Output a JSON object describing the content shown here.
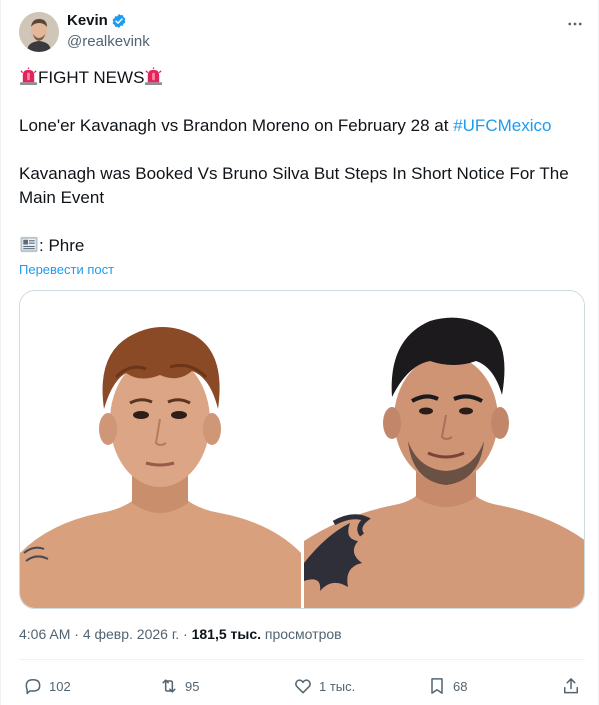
{
  "author": {
    "name": "Kevin",
    "handle": "@realkevink",
    "verified": true
  },
  "tweet": {
    "headline": "FIGHT NEWS",
    "line1_text": "Lone'er Kavanagh vs Brandon Moreno on February 28 at ",
    "line1_hashtag": "#UFCMexico",
    "line2a": "Kavanagh was Booked Vs Bruno Silva But Steps In Short Notice For The",
    "line2b": "Main Event",
    "credit": ": Phre",
    "translate_label": "Перевести пост"
  },
  "meta": {
    "time": "4:06 AM",
    "sep1": " · ",
    "date": "4 февр. 2026 г.",
    "sep2": " · ",
    "views_count": "181,5 тыс.",
    "views_label": " просмотров"
  },
  "actions": {
    "replies": "102",
    "reposts": "95",
    "likes": "1 тыс.",
    "bookmarks": "68"
  },
  "icons": [
    "siren-icon",
    "newspaper-icon",
    "verified-badge-icon",
    "more-icon",
    "reply-icon",
    "repost-icon",
    "like-icon",
    "bookmark-icon",
    "share-icon"
  ],
  "colors": {
    "accent": "#1d9bf0",
    "text": "#0f1419",
    "secondary": "#536471",
    "border": "#cfd9de"
  }
}
